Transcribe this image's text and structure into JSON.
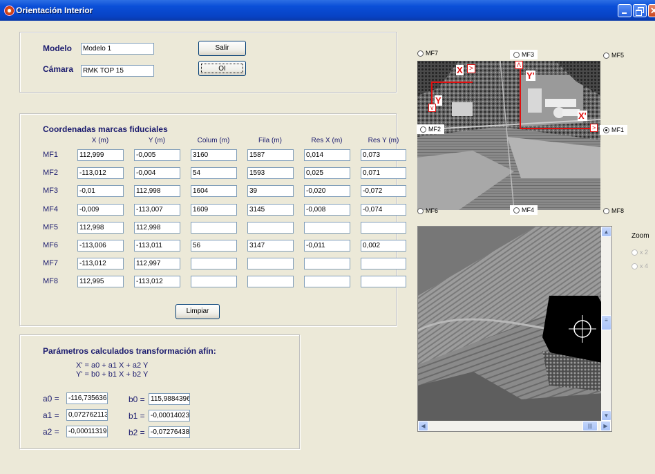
{
  "window": {
    "title": "Orientación Interior"
  },
  "model": {
    "modelo_label": "Modelo",
    "modelo_value": "Modelo 1",
    "camara_label": "Cámara",
    "camara_value": "RMK TOP 15",
    "salir_label": "Salir",
    "oi_label": "OI"
  },
  "fiducial": {
    "title": "Coordenadas marcas fiduciales",
    "headers": [
      "X (m)",
      "Y (m)",
      "Colum (m)",
      "Fila (m)",
      "Res X (m)",
      "Res Y (m)"
    ],
    "rows": [
      {
        "label": "MF1",
        "values": [
          "112,999",
          "-0,005",
          "3160",
          "1587",
          "0,014",
          "0,073"
        ]
      },
      {
        "label": "MF2",
        "values": [
          "-113,012",
          "-0,004",
          "54",
          "1593",
          "0,025",
          "0,071"
        ]
      },
      {
        "label": "MF3",
        "values": [
          "-0,01",
          "112,998",
          "1604",
          "39",
          "-0,020",
          "-0,072"
        ]
      },
      {
        "label": "MF4",
        "values": [
          "-0,009",
          "-113,007",
          "1609",
          "3145",
          "-0,008",
          "-0,074"
        ]
      },
      {
        "label": "MF5",
        "values": [
          "112,998",
          "112,998",
          "",
          "",
          "",
          ""
        ]
      },
      {
        "label": "MF6",
        "values": [
          "-113,006",
          "-113,011",
          "56",
          "3147",
          "-0,011",
          "0,002"
        ]
      },
      {
        "label": "MF7",
        "values": [
          "-113,012",
          "112,997",
          "",
          "",
          "",
          ""
        ]
      },
      {
        "label": "MF8",
        "values": [
          "112,995",
          "-113,012",
          "",
          "",
          "",
          ""
        ]
      }
    ],
    "limpiar_label": "Limpiar"
  },
  "params": {
    "title": "Parámetros calculados transformación afín:",
    "eq1": "X' = a0 + a1 X + a2 Y",
    "eq2": "Y' = b0 + b1 X + b2 Y",
    "a0_label": "a0 =",
    "a0": "-116,735636",
    "a1_label": "a1 =",
    "a1": "0,072762113",
    "a2_label": "a2 =",
    "a2": "-0,000113199",
    "b0_label": "b0 =",
    "b0": "115,9884396",
    "b1_label": "b1 =",
    "b1": "-0,00014023",
    "b2_label": "b2 =",
    "b2": "-0,07276438"
  },
  "photo": {
    "marks": {
      "MF7": "MF7",
      "MF3": "MF3",
      "MF5": "MF5",
      "MF2": "MF2",
      "MF1": "MF1",
      "MF6": "MF6",
      "MF4": "MF4",
      "MF8": "MF8"
    },
    "selected": "MF1",
    "axis_labels": {
      "x": "X",
      "y": "Y",
      "xp": "X'",
      "yp": "Y'"
    }
  },
  "zoom": {
    "label": "Zoom",
    "x2": "x 2",
    "x4": "x 4"
  },
  "colors": {
    "title_bar": "#0a4fd8",
    "panel_bg": "#ece9d8",
    "label_text": "#1a1a6e",
    "axis_red": "#e01010"
  }
}
